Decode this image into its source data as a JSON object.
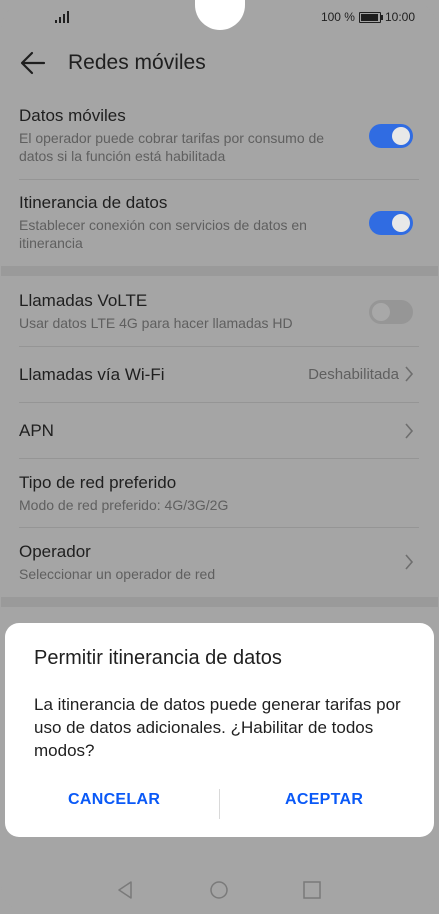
{
  "status_bar": {
    "battery": "100 %",
    "time": "10:00"
  },
  "app_bar": {
    "title": "Redes móviles"
  },
  "settings": {
    "datos_moviles": {
      "title": "Datos móviles",
      "subtitle": "El operador puede cobrar tarifas por consumo de datos si la función está habilitada",
      "enabled": true
    },
    "itinerancia": {
      "title": "Itinerancia de datos",
      "subtitle": "Establecer conexión con servicios de datos en itinerancia",
      "enabled": true
    },
    "volte": {
      "title": "Llamadas VoLTE",
      "subtitle": "Usar datos LTE 4G para hacer llamadas HD",
      "enabled": false
    },
    "wifi_calling": {
      "title": "Llamadas vía Wi-Fi",
      "value": "Deshabilitada"
    },
    "apn": {
      "title": "APN"
    },
    "tipo_red": {
      "title": "Tipo de red preferido",
      "subtitle": "Modo de red preferido: 4G/3G/2G"
    },
    "operador": {
      "title": "Operador",
      "subtitle": "Seleccionar un operador de red"
    }
  },
  "dialog": {
    "title": "Permitir itinerancia de datos",
    "body": "La itinerancia de datos puede generar tarifas por uso de datos adicionales. ¿Habilitar de todos modos?",
    "cancel_label": "CANCELAR",
    "accept_label": "ACEPTAR"
  },
  "icons": [
    "signal-icon",
    "battery-icon",
    "back-arrow-icon",
    "chevron-right-icon",
    "nav-back-icon",
    "nav-home-icon",
    "nav-recents-icon"
  ],
  "colors": {
    "accent": "#0a59f7",
    "scrim_background": "#a5a5a5"
  }
}
